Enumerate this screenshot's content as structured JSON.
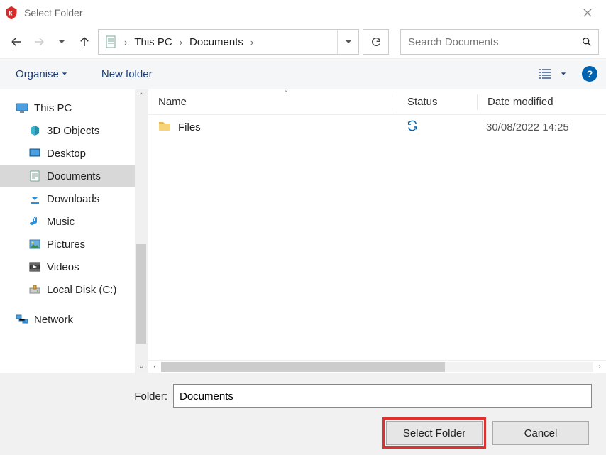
{
  "window": {
    "title": "Select Folder"
  },
  "breadcrumbs": {
    "items": [
      "This PC",
      "Documents"
    ]
  },
  "search": {
    "placeholder": "Search Documents"
  },
  "toolbar": {
    "organise": "Organise",
    "newfolder": "New folder"
  },
  "sidebar": {
    "root": "This PC",
    "items": [
      {
        "label": "3D Objects"
      },
      {
        "label": "Desktop"
      },
      {
        "label": "Documents",
        "selected": true
      },
      {
        "label": "Downloads"
      },
      {
        "label": "Music"
      },
      {
        "label": "Pictures"
      },
      {
        "label": "Videos"
      },
      {
        "label": "Local Disk (C:)"
      }
    ],
    "network": "Network"
  },
  "columns": {
    "name": "Name",
    "status": "Status",
    "date": "Date modified"
  },
  "rows": [
    {
      "name": "Files",
      "status": "sync",
      "date": "30/08/2022 14:25"
    }
  ],
  "folder": {
    "label": "Folder:",
    "value": "Documents"
  },
  "buttons": {
    "select": "Select Folder",
    "cancel": "Cancel"
  }
}
